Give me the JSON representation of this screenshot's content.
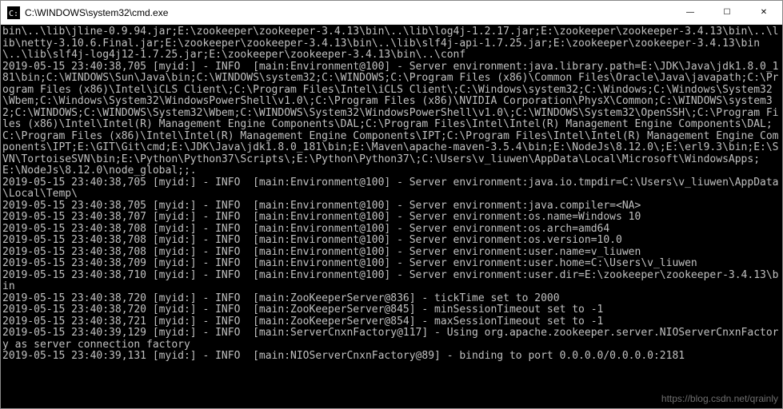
{
  "titlebar": {
    "icon": "cmd-icon",
    "title": "C:\\WINDOWS\\system32\\cmd.exe"
  },
  "controls": {
    "minimize": "—",
    "maximize": "☐",
    "close": "✕"
  },
  "console_lines": [
    "bin\\..\\lib\\jline-0.9.94.jar;E:\\zookeeper\\zookeeper-3.4.13\\bin\\..\\lib\\log4j-1.2.17.jar;E:\\zookeeper\\zookeeper-3.4.13\\bin\\..\\lib\\netty-3.10.6.Final.jar;E:\\zookeeper\\zookeeper-3.4.13\\bin\\..\\lib\\slf4j-api-1.7.25.jar;E:\\zookeeper\\zookeeper-3.4.13\\bin\\..\\lib\\slf4j-log4j12-1.7.25.jar;E:\\zookeeper\\zookeeper-3.4.13\\bin\\..\\conf",
    "2019-05-15 23:40:38,705 [myid:] - INFO  [main:Environment@100] - Server environment:java.library.path=E:\\JDK\\Java\\jdk1.8.0_181\\bin;C:\\WINDOWS\\Sun\\Java\\bin;C:\\WINDOWS\\system32;C:\\WINDOWS;C:\\Program Files (x86)\\Common Files\\Oracle\\Java\\javapath;C:\\Program Files (x86)\\Intel\\iCLS Client\\;C:\\Program Files\\Intel\\iCLS Client\\;C:\\Windows\\system32;C:\\Windows;C:\\Windows\\System32\\Wbem;C:\\Windows\\System32\\WindowsPowerShell\\v1.0\\;C:\\Program Files (x86)\\NVIDIA Corporation\\PhysX\\Common;C:\\WINDOWS\\system32;C:\\WINDOWS;C:\\WINDOWS\\System32\\Wbem;C:\\WINDOWS\\System32\\WindowsPowerShell\\v1.0\\;C:\\WINDOWS\\System32\\OpenSSH\\;C:\\Program Files (x86)\\Intel\\Intel(R) Management Engine Components\\DAL;C:\\Program Files\\Intel\\Intel(R) Management Engine Components\\DAL;C:\\Program Files (x86)\\Intel\\Intel(R) Management Engine Components\\IPT;C:\\Program Files\\Intel\\Intel(R) Management Engine Components\\IPT;E:\\GIT\\Git\\cmd;E:\\JDK\\Java\\jdk1.8.0_181\\bin;E:\\Maven\\apache-maven-3.5.4\\bin;E:\\NodeJs\\8.12.0\\;E:\\erl9.3\\bin;E:\\SVN\\TortoiseSVN\\bin;E:\\Python\\Python37\\Scripts\\;E:\\Python\\Python37\\;C:\\Users\\v_liuwen\\AppData\\Local\\Microsoft\\WindowsApps;E:\\NodeJs\\8.12.0\\node_global;;.",
    "2019-05-15 23:40:38,705 [myid:] - INFO  [main:Environment@100] - Server environment:java.io.tmpdir=C:\\Users\\v_liuwen\\AppData\\Local\\Temp\\",
    "2019-05-15 23:40:38,705 [myid:] - INFO  [main:Environment@100] - Server environment:java.compiler=<NA>",
    "2019-05-15 23:40:38,707 [myid:] - INFO  [main:Environment@100] - Server environment:os.name=Windows 10",
    "2019-05-15 23:40:38,708 [myid:] - INFO  [main:Environment@100] - Server environment:os.arch=amd64",
    "2019-05-15 23:40:38,708 [myid:] - INFO  [main:Environment@100] - Server environment:os.version=10.0",
    "2019-05-15 23:40:38,708 [myid:] - INFO  [main:Environment@100] - Server environment:user.name=v_liuwen",
    "2019-05-15 23:40:38,709 [myid:] - INFO  [main:Environment@100] - Server environment:user.home=C:\\Users\\v_liuwen",
    "2019-05-15 23:40:38,710 [myid:] - INFO  [main:Environment@100] - Server environment:user.dir=E:\\zookeeper\\zookeeper-3.4.13\\bin",
    "",
    "2019-05-15 23:40:38,720 [myid:] - INFO  [main:ZooKeeperServer@836] - tickTime set to 2000",
    "2019-05-15 23:40:38,720 [myid:] - INFO  [main:ZooKeeperServer@845] - minSessionTimeout set to -1",
    "2019-05-15 23:40:38,721 [myid:] - INFO  [main:ZooKeeperServer@854] - maxSessionTimeout set to -1",
    "2019-05-15 23:40:39,129 [myid:] - INFO  [main:ServerCnxnFactory@117] - Using org.apache.zookeeper.server.NIOServerCnxnFactory as server connection factory",
    "2019-05-15 23:40:39,131 [myid:] - INFO  [main:NIOServerCnxnFactory@89] - binding to port 0.0.0.0/0.0.0.0:2181"
  ],
  "watermark": "https://blog.csdn.net/qrainly"
}
